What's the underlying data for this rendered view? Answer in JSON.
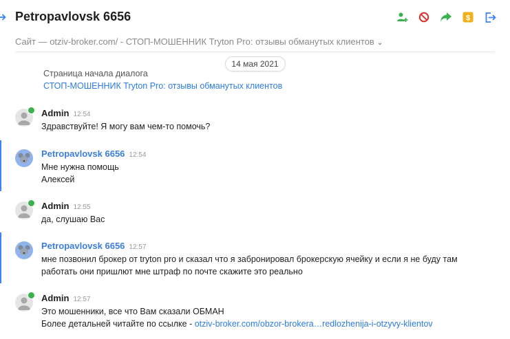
{
  "header": {
    "title": "Petropavlovsk 6656",
    "subline": "Сайт — otziv-broker.com/ - СТОП-МОШЕННИК Tryton Pro: отзывы обманутых клиентов",
    "toolbar": [
      {
        "icon": "add-user-icon",
        "color": "#37b24d"
      },
      {
        "icon": "block-icon",
        "color": "#e03131"
      },
      {
        "icon": "forward-icon",
        "color": "#37b24d"
      },
      {
        "icon": "dollar-icon",
        "color": "#f2b01e"
      },
      {
        "icon": "exit-icon",
        "color": "#3b82f6"
      }
    ]
  },
  "date_pill": "14 мая 2021",
  "start": {
    "label": "Страница начала диалога",
    "link": "СТОП-МОШЕННИК Tryton Pro: отзывы обманутых клиентов"
  },
  "messages": [
    {
      "author": "Admin",
      "time": "12:54",
      "lines": [
        "Здравствуйте! Я могу вам чем-то помочь?"
      ]
    },
    {
      "author": "Petropavlovsk 6656",
      "time": "12:54",
      "lines": [
        "Мне нужна помощь",
        "Алексей"
      ]
    },
    {
      "author": "Admin",
      "time": "12:55",
      "lines": [
        "да, слушаю Вас"
      ]
    },
    {
      "author": "Petropavlovsk 6656",
      "time": "12:57",
      "lines": [
        "мне позвонил брокер от tryton pro и сказал что я забронировал брокерскую ячейку и если я не буду там",
        "работать они пришлют мне штраф по почте скажите это реально"
      ]
    },
    {
      "author": "Admin",
      "time": "12:57",
      "lines": [
        "Это мошенники, все что Вам сказали ОБМАН"
      ],
      "link_prefix": "Более детальней читайте по ссылке - ",
      "link_text": "otziv-broker.com/obzor-brokera…redlozhenija-i-otzyvy-klientov"
    }
  ]
}
